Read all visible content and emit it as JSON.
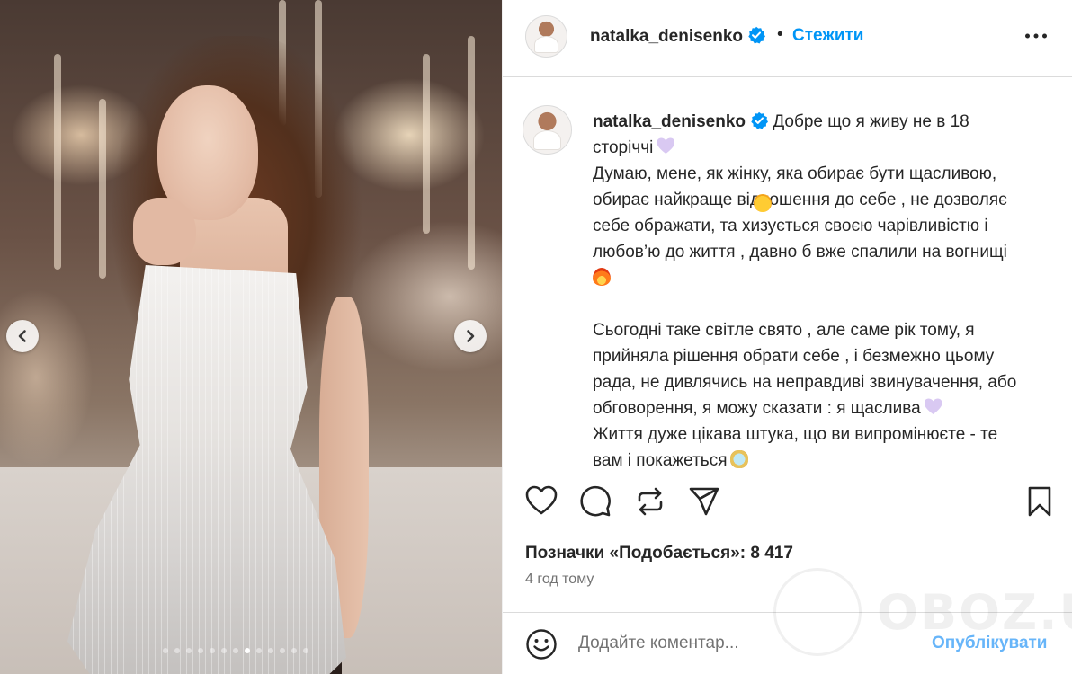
{
  "post": {
    "username": "natalka_denisenko",
    "separator": "•",
    "follow_label": "Стежити",
    "verified_icon": "verified-badge-icon",
    "more_icon": "more-horizontal-icon"
  },
  "caption": {
    "username": "natalka_denisenko",
    "lines": [
      "Добре що я живу не в 18",
      "сторіччі",
      "Думаю, мене, як жінку, яка обирає бути щасливою,",
      "обирає найкраще відношення до себе , не дозволяє",
      "себе ображати, та хизується своєю чарівливістю і",
      "любов’ю до життя , давно б вже спалили на вогнищі",
      "",
      "",
      "Сьогодні таке світле свято , але саме рік тому, я",
      "прийняла рішення обрати себе , і безмежно цьому",
      "рада, не дивлячись на неправдиві звинувачення, або",
      "обговорення, я можу сказати : я щаслива",
      "Життя дуже цікава штука, що ви випромінюєте - те",
      "вам і покажеться"
    ],
    "emojis": [
      "purple-heart-emoji",
      "fire-emoji",
      "smiling-face-emoji",
      "purple-heart-emoji",
      "mirror-emoji"
    ]
  },
  "carousel": {
    "prev_icon": "chevron-left-icon",
    "next_icon": "chevron-right-icon",
    "slide_count": 13,
    "active_slide": 8
  },
  "actions": {
    "icons": [
      "heart-icon",
      "comment-icon",
      "repost-icon",
      "share-icon",
      "bookmark-icon"
    ],
    "likes_text": "Позначки «Подобається»: 8 417",
    "time_text": "4 год тому"
  },
  "comment": {
    "placeholder": "Додайте коментар...",
    "publish_label": "Опублікувати",
    "emoji_icon": "emoji-smile-icon"
  },
  "watermark": {
    "text": "OBOZ.UA"
  },
  "colors": {
    "link_blue": "#0095f6",
    "publish_blue": "#67b5f9",
    "verified_blue": "#0095f6"
  }
}
